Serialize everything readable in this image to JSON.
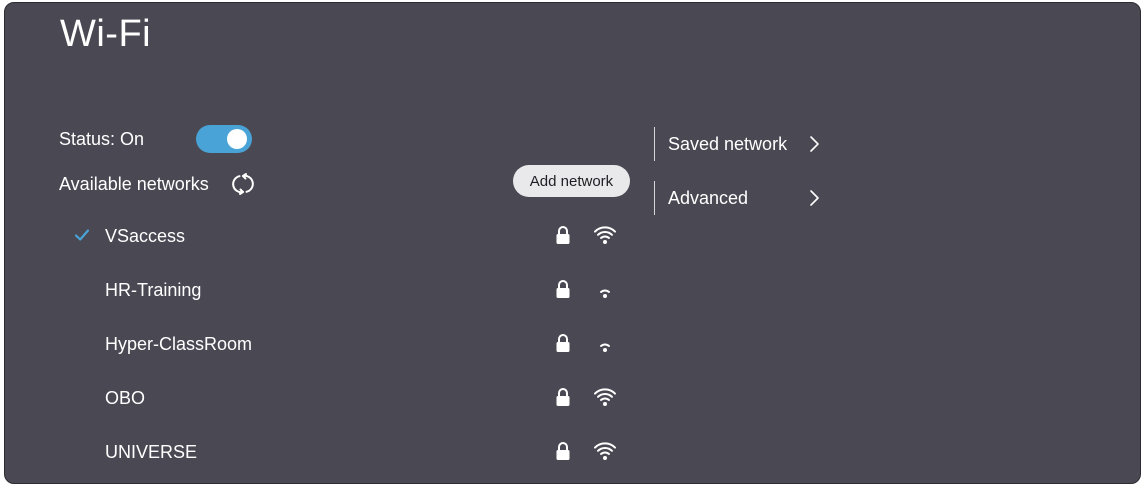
{
  "page": {
    "title": "Wi-Fi"
  },
  "status": {
    "label": "Status: On",
    "enabled": true,
    "toggle_color": "#4aa3d6"
  },
  "available": {
    "label": "Available networks",
    "refresh_icon": "refresh-icon"
  },
  "add_network": {
    "label": "Add network"
  },
  "networks": [
    {
      "name": "VSaccess",
      "connected": true,
      "secured": true,
      "signal": "strong"
    },
    {
      "name": "HR-Training",
      "connected": false,
      "secured": true,
      "signal": "weak"
    },
    {
      "name": "Hyper-ClassRoom",
      "connected": false,
      "secured": true,
      "signal": "weak"
    },
    {
      "name": "OBO",
      "connected": false,
      "secured": true,
      "signal": "strong"
    },
    {
      "name": "UNIVERSE",
      "connected": false,
      "secured": true,
      "signal": "strong"
    }
  ],
  "menu": [
    {
      "label": "Saved network",
      "icon": "chevron-right-icon"
    },
    {
      "label": "Advanced",
      "icon": "chevron-right-icon"
    }
  ],
  "colors": {
    "background": "#4a4953",
    "accent": "#4aa3d6",
    "text": "#ffffff",
    "pill": "#e9e9ec"
  }
}
